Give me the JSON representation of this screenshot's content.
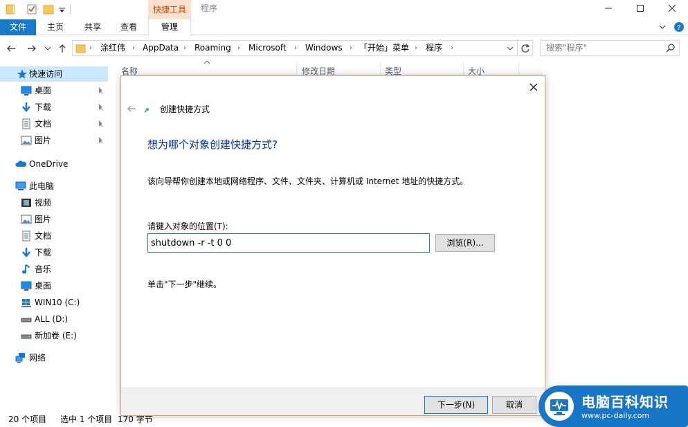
{
  "titlebar": {
    "context_tab": "快捷工具",
    "window_title": "程序"
  },
  "ribbon": {
    "tabs": [
      "文件",
      "主页",
      "共享",
      "查看",
      "管理"
    ]
  },
  "addressbar": {
    "crumbs": [
      "涂红伟",
      "AppData",
      "Roaming",
      "Microsoft",
      "Windows",
      "「开始」菜单",
      "程序"
    ],
    "search_placeholder": "搜索\"程序\""
  },
  "nav": {
    "quick_access": "快速访问",
    "quick_items": [
      "桌面",
      "下载",
      "文档",
      "图片"
    ],
    "onedrive": "OneDrive",
    "this_pc": "此电脑",
    "pc_items": [
      "视频",
      "图片",
      "文档",
      "下载",
      "音乐",
      "桌面",
      "WIN10 (C:)",
      "ALL (D:)",
      "新加卷 (E:)"
    ],
    "network": "网络"
  },
  "filelist": {
    "columns": [
      "名称",
      "修改日期",
      "类型",
      "大小"
    ]
  },
  "status": {
    "count": "20 个项目",
    "selection": "选中 1 个项目",
    "size": "170 字节"
  },
  "dialog": {
    "title": "创建快捷方式",
    "heading": "想为哪个对象创建快捷方式?",
    "description": "该向导帮你创建本地或网络程序、文件、文件夹、计算机或 Internet 地址的快捷方式。",
    "field_label": "请键入对象的位置(T):",
    "location_value": "shutdown -r -t 0 0",
    "browse_label": "浏览(R)...",
    "hint": "单击\"下一步\"继续。",
    "next_label": "下一步(N)",
    "cancel_label": "取消"
  },
  "watermark": {
    "title": "电脑百科知识",
    "url": "www.pc-daily.com"
  },
  "colors": {
    "accent": "#1979ca",
    "context_tab_bg": "#fbe0d0",
    "heading": "#003399"
  }
}
